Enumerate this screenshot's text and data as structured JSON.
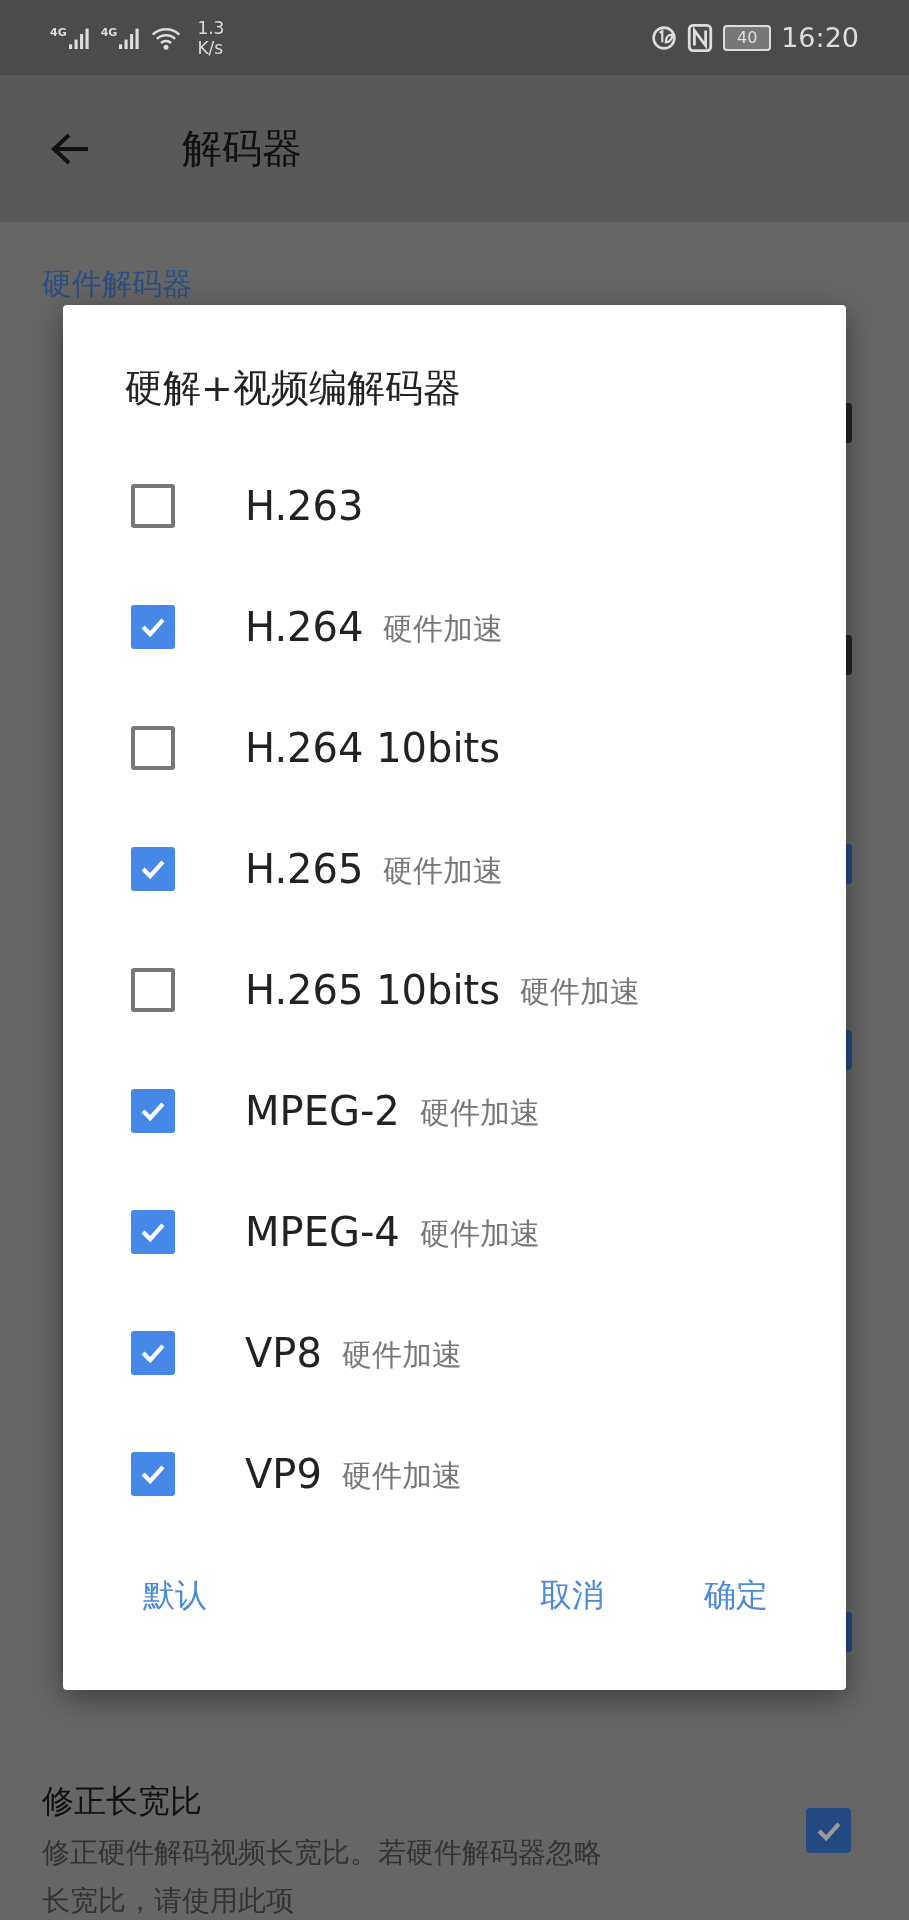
{
  "status_bar": {
    "network_1": "4G",
    "network_2": "4G",
    "speed_value": "1.3",
    "speed_unit": "K/s",
    "battery": "40",
    "time": "16:20"
  },
  "app_bar": {
    "title": "解码器"
  },
  "section_header": "硬件解码器",
  "settings": [
    {
      "kind": "covered",
      "checked": false
    },
    {
      "kind": "covered",
      "checked": false
    },
    {
      "kind": "covered",
      "checked": true
    },
    {
      "kind": "covered",
      "checked": true
    },
    {
      "kind": "blank"
    },
    {
      "kind": "blank"
    },
    {
      "kind": "covered",
      "checked": true
    },
    {
      "kind": "full",
      "title": "修正长宽比",
      "description": [
        "修正硬件解码视频长宽比。若硬件解码器忽略",
        "长宽比，请使用此项"
      ],
      "checked": true
    }
  ],
  "dialog": {
    "title": "硬解+视频编解码器",
    "codecs": [
      {
        "label": "H.263",
        "checked": false
      },
      {
        "label": "H.264",
        "checked": true,
        "tag": "硬件加速"
      },
      {
        "label": "H.264 10bits",
        "checked": false
      },
      {
        "label": "H.265",
        "checked": true,
        "tag": "硬件加速"
      },
      {
        "label": "H.265 10bits",
        "checked": false,
        "tag": "硬件加速"
      },
      {
        "label": "MPEG-2",
        "checked": true,
        "tag": "硬件加速"
      },
      {
        "label": "MPEG-4",
        "checked": true,
        "tag": "硬件加速"
      },
      {
        "label": "VP8",
        "checked": true,
        "tag": "硬件加速"
      },
      {
        "label": "VP9",
        "checked": true,
        "tag": "硬件加速"
      }
    ],
    "buttons": {
      "left": "默认",
      "cancel": "取消",
      "ok": "确定"
    }
  }
}
